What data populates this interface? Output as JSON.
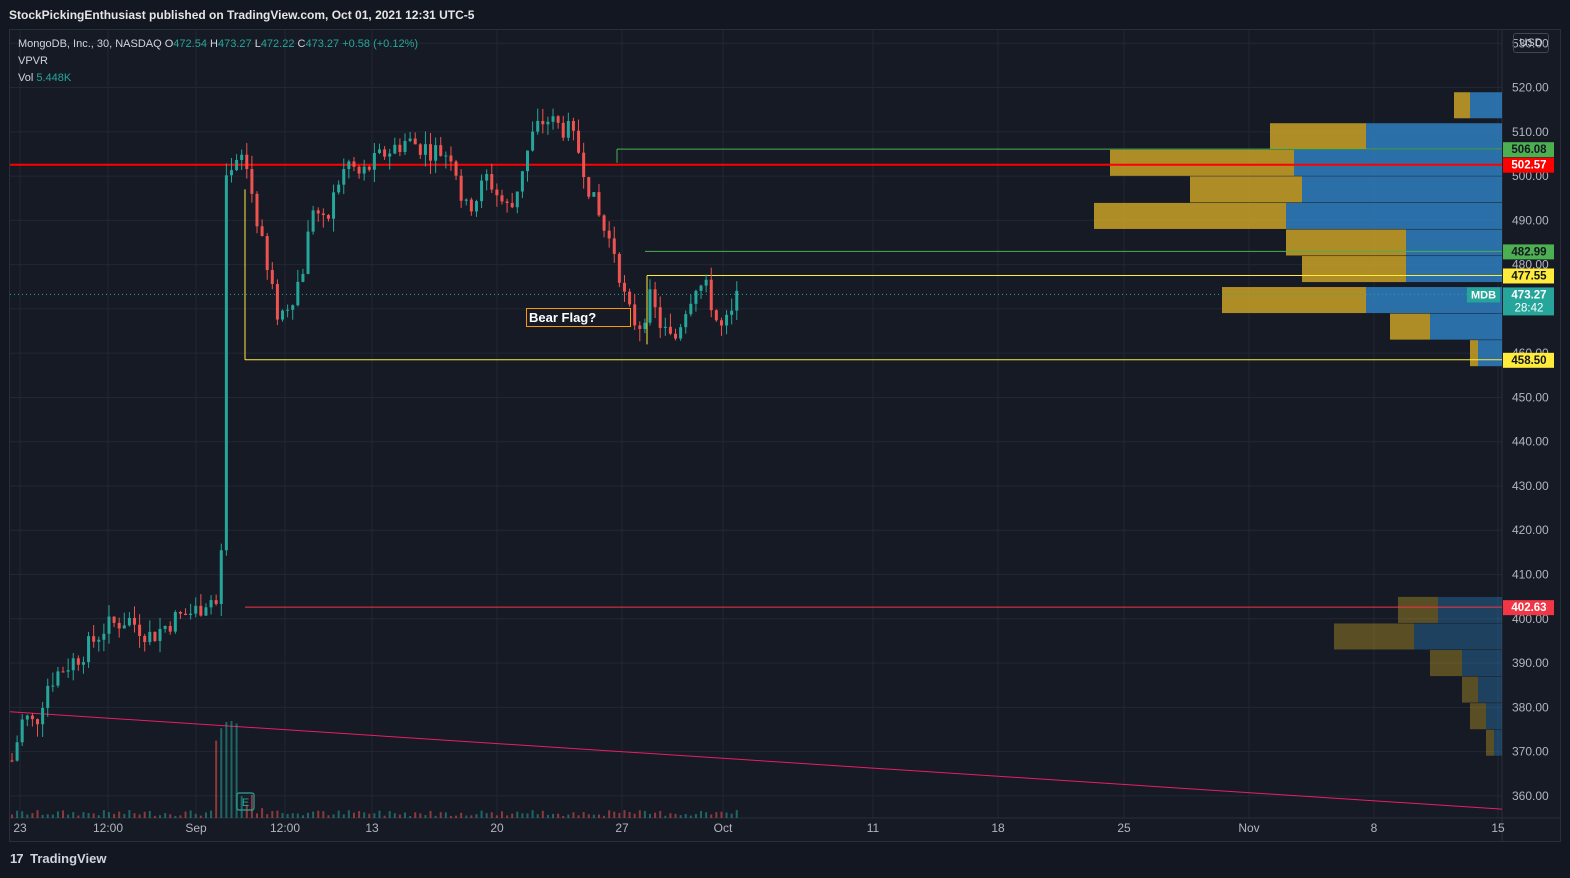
{
  "publisher_line": "StockPickingEnthusiast published on TradingView.com, Oct 01, 2021 12:31 UTC-5",
  "legend": {
    "symbol": "MongoDB, Inc., 30, NASDAQ",
    "open_label": "O",
    "open": "472.54",
    "high_label": "H",
    "high": "473.27",
    "low_label": "L",
    "low": "472.22",
    "close_label": "C",
    "close": "473.27",
    "change": "+0.58 (+0.12%)",
    "indicator": "VPVR",
    "vol_label": "Vol",
    "vol": "5.448K"
  },
  "currency": "USD",
  "annotation": "Bear Flag?",
  "footer": {
    "logo": "17",
    "brand": "TradingView"
  },
  "colors": {
    "background": "#161a25",
    "grid": "#232734",
    "up": "#26a69a",
    "down": "#ef5350",
    "resistance": "#ff0000",
    "support_green": "#4caf50",
    "support_yellow": "#ffeb3b",
    "gap_line": "#f23645",
    "trendline": "#e91e63",
    "vpvr_up": "#2f7fc1",
    "vpvr_down": "#c9a227"
  },
  "chart_data": {
    "type": "candlestick",
    "symbol": "MDB",
    "y_ticks": [
      360,
      370,
      380,
      390,
      400,
      410,
      420,
      430,
      440,
      450,
      460,
      470,
      480,
      490,
      500,
      510,
      520,
      530
    ],
    "ylim": [
      355,
      533
    ],
    "x_ticks": [
      "23",
      "12:00",
      "Sep",
      "12:00",
      "13",
      "20",
      "27",
      "Oct",
      "11",
      "18",
      "25",
      "Nov",
      "8",
      "15"
    ],
    "price_labels": [
      {
        "value": 506.08,
        "text": "506.08",
        "color": "#4caf50"
      },
      {
        "value": 502.57,
        "text": "502.57",
        "color": "#ff0000"
      },
      {
        "value": 482.99,
        "text": "482.99",
        "color": "#4caf50"
      },
      {
        "value": 477.55,
        "text": "477.55",
        "color": "#ffeb3b"
      },
      {
        "value": 473.27,
        "text": "473.27",
        "color": "#26a69a",
        "sub": "28:42",
        "tag": "MDB"
      },
      {
        "value": 458.5,
        "text": "458.50",
        "color": "#ffeb3b"
      },
      {
        "value": 402.63,
        "text": "402.63",
        "color": "#f23645"
      }
    ],
    "horizontal_lines": [
      {
        "name": "resistance",
        "value": 502.57,
        "from": "Aug 23",
        "to": "Nov 15"
      },
      {
        "name": "green-upper",
        "value": 506.08,
        "from": "Sep 27",
        "to": "Nov 15"
      },
      {
        "name": "green-lower",
        "value": 482.99,
        "from": "Sep 28",
        "to": "Nov 15"
      },
      {
        "name": "yellow-upper",
        "value": 477.55,
        "from": "Sep 28",
        "to": "Nov 15"
      },
      {
        "name": "yellow-lower",
        "value": 458.5,
        "from": "Sep 9",
        "to": "Nov 15"
      },
      {
        "name": "gap",
        "value": 402.63,
        "from": "Sep 9",
        "to": "Nov 15"
      }
    ],
    "trendline": {
      "from": {
        "x": "Aug 23",
        "y": 379
      },
      "to": {
        "x": "Nov 15",
        "y": 357
      }
    },
    "price_path": [
      {
        "t": 0.0,
        "p": 368
      },
      {
        "t": 0.5,
        "p": 378
      },
      {
        "t": 1.0,
        "p": 376
      },
      {
        "t": 1.5,
        "p": 385
      },
      {
        "t": 2.0,
        "p": 388
      },
      {
        "t": 3.0,
        "p": 392
      },
      {
        "t": 4.0,
        "p": 398
      },
      {
        "t": 5.0,
        "p": 400
      },
      {
        "t": 6.0,
        "p": 396
      },
      {
        "t": 7.0,
        "p": 400
      },
      {
        "t": 8.0,
        "p": 402
      },
      {
        "t": 8.5,
        "p": 405
      },
      {
        "t": 9.0,
        "p": 402
      },
      {
        "t": 9.15,
        "p": 497
      },
      {
        "t": 10.0,
        "p": 505
      },
      {
        "t": 10.5,
        "p": 492
      },
      {
        "t": 11.0,
        "p": 478
      },
      {
        "t": 11.5,
        "p": 468
      },
      {
        "t": 12.0,
        "p": 472
      },
      {
        "t": 12.5,
        "p": 478
      },
      {
        "t": 13.0,
        "p": 494
      },
      {
        "t": 13.5,
        "p": 488
      },
      {
        "t": 14.0,
        "p": 498
      },
      {
        "t": 14.5,
        "p": 503
      },
      {
        "t": 15.0,
        "p": 500
      },
      {
        "t": 16.0,
        "p": 505
      },
      {
        "t": 17.0,
        "p": 508
      },
      {
        "t": 18.0,
        "p": 506
      },
      {
        "t": 19.0,
        "p": 505
      },
      {
        "t": 19.5,
        "p": 492
      },
      {
        "t": 20.0,
        "p": 495
      },
      {
        "t": 20.5,
        "p": 500
      },
      {
        "t": 21.0,
        "p": 495
      },
      {
        "t": 21.5,
        "p": 492
      },
      {
        "t": 22.0,
        "p": 502
      },
      {
        "t": 22.5,
        "p": 510
      },
      {
        "t": 23.0,
        "p": 513
      },
      {
        "t": 24.0,
        "p": 510
      },
      {
        "t": 24.5,
        "p": 505
      },
      {
        "t": 25.0,
        "p": 495
      },
      {
        "t": 25.5,
        "p": 488
      },
      {
        "t": 26.0,
        "p": 483
      },
      {
        "t": 26.5,
        "p": 470
      },
      {
        "t": 27.0,
        "p": 466
      },
      {
        "t": 27.5,
        "p": 472
      },
      {
        "t": 28.0,
        "p": 466
      },
      {
        "t": 28.5,
        "p": 462
      },
      {
        "t": 29.0,
        "p": 470
      },
      {
        "t": 29.5,
        "p": 476
      },
      {
        "t": 30.0,
        "p": 474
      },
      {
        "t": 30.5,
        "p": 465
      },
      {
        "t": 31.0,
        "p": 468
      },
      {
        "t": 31.3,
        "p": 473.27
      }
    ],
    "vpvr": [
      {
        "price": 516,
        "up": 4,
        "down": 2
      },
      {
        "price": 509,
        "up": 17,
        "down": 12
      },
      {
        "price": 503,
        "up": 26,
        "down": 23
      },
      {
        "price": 497,
        "up": 25,
        "down": 14
      },
      {
        "price": 491,
        "up": 27,
        "down": 24
      },
      {
        "price": 485,
        "up": 12,
        "down": 15
      },
      {
        "price": 479,
        "up": 12,
        "down": 13
      },
      {
        "price": 472,
        "up": 17,
        "down": 18
      },
      {
        "price": 466,
        "up": 9,
        "down": 5
      },
      {
        "price": 460,
        "up": 3,
        "down": 1
      },
      {
        "price": 402,
        "up": 8,
        "down": 5
      },
      {
        "price": 396,
        "up": 11,
        "down": 10
      },
      {
        "price": 390,
        "up": 5,
        "down": 4
      },
      {
        "price": 384,
        "up": 3,
        "down": 2
      },
      {
        "price": 378,
        "up": 2,
        "down": 2
      },
      {
        "price": 372,
        "up": 1,
        "down": 1
      }
    ]
  }
}
